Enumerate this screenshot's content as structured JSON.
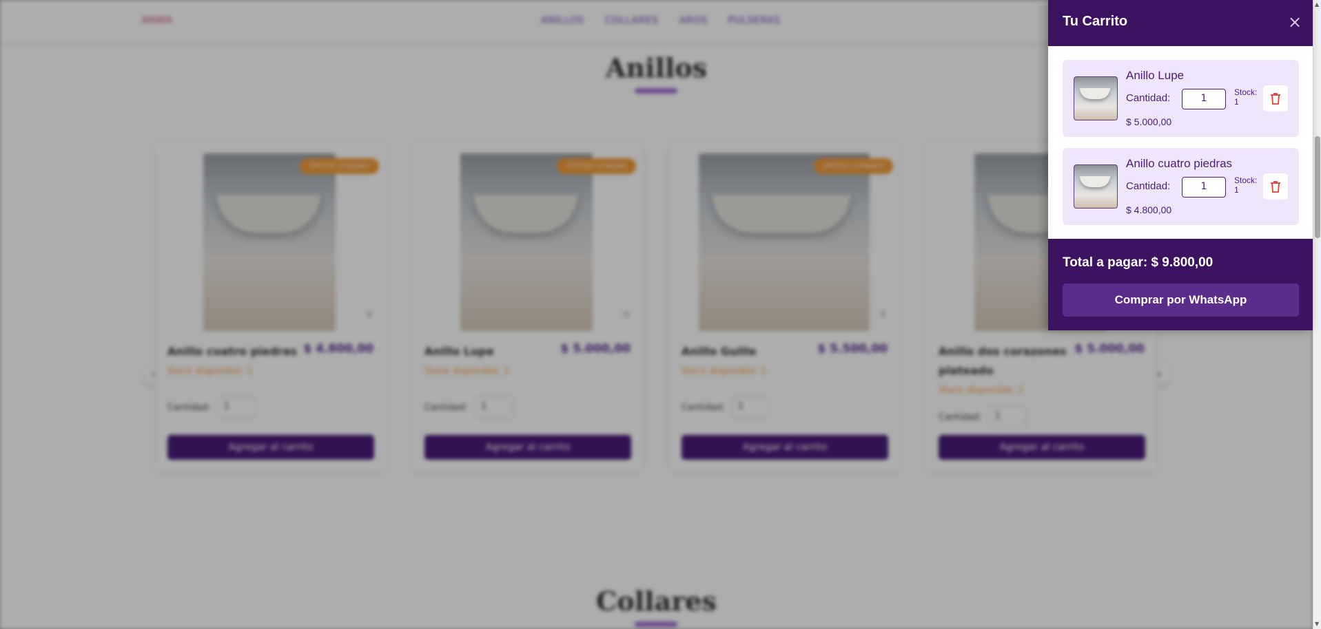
{
  "background": {
    "logo": "AMAYA",
    "nav": [
      "ANILLOS",
      "COLLARES",
      "AROS",
      "PULSERAS"
    ],
    "section_title": "Anillos",
    "next_section_title": "Collares",
    "products": [
      {
        "badge": "Últimas unidades",
        "name": "Anillo cuatro piedras",
        "price": "$ 4.800,00",
        "stock": "Stock disponible: 1",
        "qty_label": "Cantidad:",
        "qty": "1",
        "button": "Agregar al carrito"
      },
      {
        "badge": "Últimas unidades",
        "name": "Anillo Lupe",
        "price": "$ 5.000,00",
        "stock": "Stock disponible: 1",
        "qty_label": "Cantidad:",
        "qty": "1",
        "button": "Agregar al carrito"
      },
      {
        "badge": "Últimas unidades",
        "name": "Anillo Guille",
        "price": "$ 5.500,00",
        "stock": "Stock disponible: 1",
        "qty_label": "Cantidad:",
        "qty": "1",
        "button": "Agregar al carrito"
      },
      {
        "badge": "",
        "name": "Anillo dos corazones plateado",
        "price": "$ 5.000,00",
        "stock": "Stock disponible: 2",
        "qty_label": "Cantidad:",
        "qty": "1",
        "button": "Agregar al carrito"
      }
    ]
  },
  "cart": {
    "title": "Tu Carrito",
    "close_icon": "×",
    "items": [
      {
        "name": "Anillo Lupe",
        "qty_label": "Cantidad:",
        "qty": "1",
        "stock": "Stock: 1",
        "price": "$ 5.000,00"
      },
      {
        "name": "Anillo cuatro piedras",
        "qty_label": "Cantidad:",
        "qty": "1",
        "stock": "Stock: 1",
        "price": "$ 4.800,00"
      }
    ],
    "total": "Total a pagar: $ 9.800,00",
    "buy_button": "Comprar por WhatsApp"
  },
  "colors": {
    "header": "#3c1361",
    "item_bg": "#efe6fb",
    "delete": "#e53935",
    "badge": "#f29b3a"
  }
}
